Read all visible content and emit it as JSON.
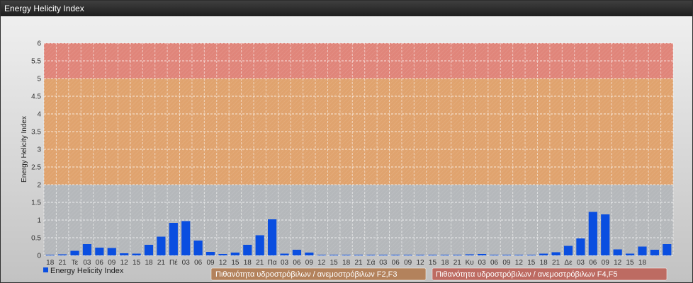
{
  "window": {
    "title": "Energy Helicity Index"
  },
  "colors": {
    "bar": "#0a4ee0",
    "band_low_color": "#b5b8bb",
    "band_mid_color": "#e0a36e",
    "band_high_color": "#e0857a",
    "band_f23_color": "#b3825c",
    "band_f45_color": "#bd6b62"
  },
  "chart_data": {
    "type": "bar",
    "ylabel": "Energy Helicity Index",
    "xlabel": "",
    "ylim": [
      0,
      6
    ],
    "yticks": [
      "0",
      "0.5",
      "1",
      "1.5",
      "2",
      "2.5",
      "3",
      "3.5",
      "4",
      "4.5",
      "5",
      "5.5",
      "6"
    ],
    "grid": true,
    "legend_position": "bottom-left",
    "categories": [
      "18",
      "21",
      "Τε",
      "03",
      "06",
      "09",
      "12",
      "15",
      "18",
      "21",
      "Πέ",
      "03",
      "06",
      "09",
      "12",
      "15",
      "18",
      "21",
      "Πα",
      "03",
      "06",
      "09",
      "12",
      "15",
      "18",
      "21",
      "Σά",
      "03",
      "06",
      "09",
      "12",
      "15",
      "18",
      "21",
      "Κυ",
      "03",
      "06",
      "09",
      "12",
      "15",
      "18",
      "21",
      "Δε",
      "03",
      "06",
      "09",
      "12",
      "15",
      "18",
      ""
    ],
    "series": [
      {
        "name": "Energy Helicity Index",
        "values": [
          0.02,
          0.03,
          0.13,
          0.32,
          0.22,
          0.21,
          0.06,
          0.05,
          0.3,
          0.53,
          0.92,
          0.97,
          0.42,
          0.1,
          0.04,
          0.08,
          0.3,
          0.57,
          1.02,
          0.05,
          0.16,
          0.08,
          0.02,
          0.02,
          0.02,
          0.02,
          0.02,
          0.02,
          0.02,
          0.02,
          0.02,
          0.02,
          0.02,
          0.02,
          0.03,
          0.04,
          0.02,
          0.02,
          0.02,
          0.02,
          0.05,
          0.09,
          0.27,
          0.48,
          1.23,
          1.16,
          0.17,
          0.05,
          0.25,
          0.16,
          0.32
        ]
      }
    ],
    "risk_bands": [
      {
        "from": 0,
        "to": 2,
        "color_key": "band_low_color"
      },
      {
        "from": 2,
        "to": 5,
        "color_key": "band_mid_color"
      },
      {
        "from": 5,
        "to": 6,
        "color_key": "band_high_color"
      }
    ],
    "legend_bands": [
      {
        "label": "Πιθανότητα υδροστρόβιλων / ανεμοστρόβιλων F2,F3",
        "color_key": "band_f23_color"
      },
      {
        "label": "Πιθανότητα υδροστρόβιλων / ανεμοστρόβιλων F4,F5",
        "color_key": "band_f45_color"
      }
    ]
  }
}
